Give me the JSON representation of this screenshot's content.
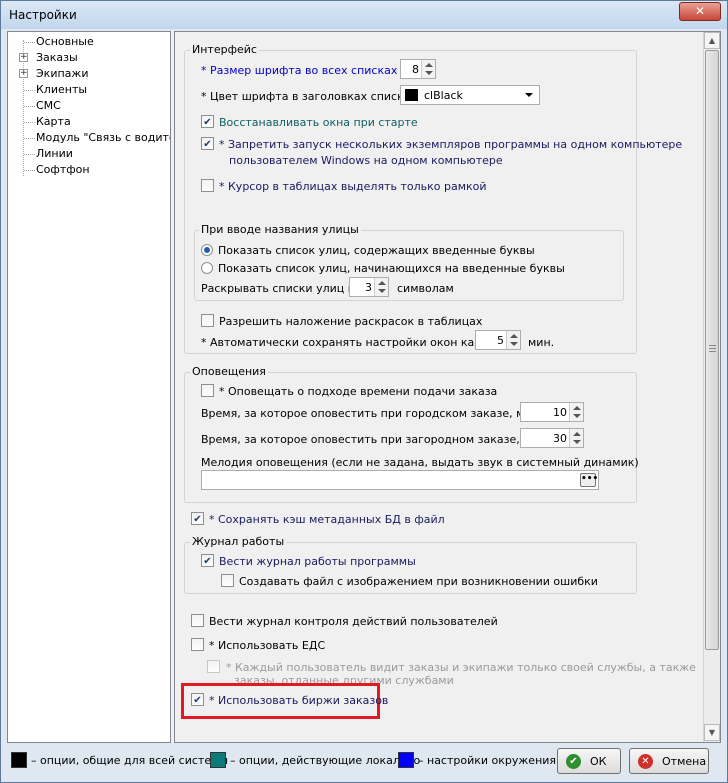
{
  "window": {
    "title": "Настройки",
    "close_glyph": "✕"
  },
  "tree": {
    "items": [
      {
        "label": "Основные",
        "expandable": false
      },
      {
        "label": "Заказы",
        "expandable": true
      },
      {
        "label": "Экипажи",
        "expandable": true
      },
      {
        "label": "Клиенты",
        "expandable": false
      },
      {
        "label": "СМС",
        "expandable": false
      },
      {
        "label": "Карта",
        "expandable": false
      },
      {
        "label": "Модуль \"Связь с водителем\"",
        "expandable": false
      },
      {
        "label": "Линии",
        "expandable": false
      },
      {
        "label": "Софтфон",
        "expandable": false
      }
    ]
  },
  "interface": {
    "legend": "Интерфейс",
    "font_size_label": "* Размер шрифта во всех списках",
    "font_size_value": "8",
    "header_color_label": "* Цвет шрифта в заголовках списков",
    "header_color_value": "clBlack",
    "restore_windows_label": "Восстанавливать окна при старте",
    "restore_windows_checked": true,
    "single_instance_label_1": "* Запретить запуск нескольких экземпляров программы на одном компьютере",
    "single_instance_label_2": "пользователем Windows на одном компьютере",
    "single_instance_checked": true,
    "cursor_frame_label": "* Курсор в таблицах выделять только рамкой",
    "cursor_frame_checked": false,
    "street": {
      "legend": "При вводе названия улицы",
      "option_contains": "Показать список улиц, содержащих введенные буквы",
      "option_starts": "Показать список улиц, начинающихся на введенные буквы",
      "selected": "contains",
      "expand_prefix": "Раскрывать списки улиц по",
      "expand_value": "3",
      "expand_suffix": "символам"
    },
    "overlay_colors_label": "Разрешить наложение раскрасок в таблицах",
    "overlay_colors_checked": false,
    "autosave_label": "* Автоматически сохранять настройки окон каждые",
    "autosave_value": "5",
    "autosave_suffix": "мин."
  },
  "notifications": {
    "legend": "Оповещения",
    "notify_label": "* Оповещать о подходе времени подачи заказа",
    "notify_checked": false,
    "city_label": "Время, за которое оповестить при городском заказе, мин:",
    "city_value": "10",
    "suburb_label": "Время, за которое оповестить при загородном заказе, мин:",
    "suburb_value": "30",
    "melody_label": "Мелодия оповещения (если не задана, выдать звук в системный динамик)",
    "melody_value": "",
    "browse_label": "•••"
  },
  "cache": {
    "label": "* Сохранять кэш метаданных БД в файл",
    "checked": true
  },
  "journal": {
    "legend": "Журнал работы",
    "keep_label": "Вести журнал работы программы",
    "keep_checked": true,
    "screenshot_label": "Создавать файл с изображением при возникновении ошибки",
    "screenshot_checked": false
  },
  "user_actions": {
    "label": "Вести журнал контроля действий пользователей",
    "checked": false
  },
  "eds": {
    "label": "* Использовать ЕДС",
    "checked": false
  },
  "own_service": {
    "label_1": "* Каждый пользователь видит заказы и экипажи только своей службы, а также",
    "label_2": "заказы, отданные другими службами",
    "checked": false
  },
  "exchanges": {
    "label": "* Использовать биржи заказов",
    "checked": true
  },
  "legend_bar": {
    "global": "– опции, общие для всей системы",
    "local": "– опции, действующие локально",
    "env": "– настройки окружения",
    "colors": {
      "global": "#000000",
      "local": "#0a7a7a",
      "env": "#0000ff"
    }
  },
  "buttons": {
    "ok": "ОК",
    "cancel": "Отмена"
  }
}
